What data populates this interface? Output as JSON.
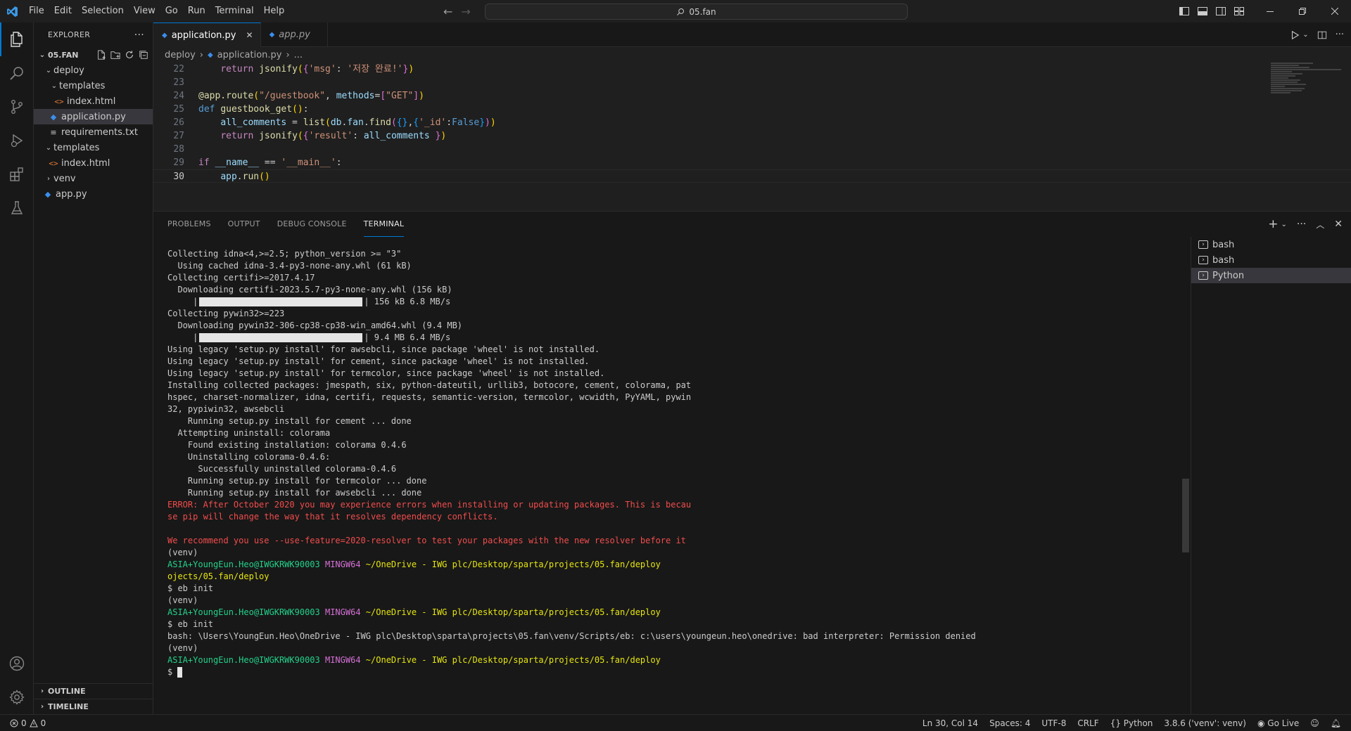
{
  "menu": [
    "File",
    "Edit",
    "Selection",
    "View",
    "Go",
    "Run",
    "Terminal",
    "Help"
  ],
  "command_center": {
    "text": "05.fan"
  },
  "sidebar": {
    "title": "EXPLORER",
    "root": "05.FAN",
    "tree": [
      {
        "label": "deploy",
        "type": "folder"
      },
      {
        "label": "templates",
        "type": "folder"
      },
      {
        "label": "index.html",
        "type": "html"
      },
      {
        "label": "application.py",
        "type": "py"
      },
      {
        "label": "requirements.txt",
        "type": "txt"
      },
      {
        "label": "templates",
        "type": "folder"
      },
      {
        "label": "index.html",
        "type": "html"
      },
      {
        "label": "venv",
        "type": "folder"
      },
      {
        "label": "app.py",
        "type": "py"
      }
    ],
    "outline": "OUTLINE",
    "timeline": "TIMELINE"
  },
  "editor": {
    "tabs": [
      {
        "label": "application.py"
      },
      {
        "label": "app.py"
      }
    ],
    "breadcrumb": {
      "folder": "deploy",
      "file": "application.py",
      "more": "..."
    },
    "lines": [
      {
        "num": "22",
        "text": "    return jsonify({'msg': '저장 완료!'})"
      },
      {
        "num": "23",
        "text": ""
      },
      {
        "num": "24",
        "text": "@app.route(\"/guestbook\", methods=[\"GET\"])"
      },
      {
        "num": "25",
        "text": "def guestbook_get():"
      },
      {
        "num": "26",
        "text": "    all_comments = list(db.fan.find({},{'_id':False}))"
      },
      {
        "num": "27",
        "text": "    return jsonify({'result': all_comments })"
      },
      {
        "num": "28",
        "text": ""
      },
      {
        "num": "29",
        "text": "if __name__ == '__main__':"
      },
      {
        "num": "30",
        "text": "    app.run()"
      }
    ]
  },
  "panel": {
    "tabs": [
      "PROBLEMS",
      "OUTPUT",
      "DEBUG CONSOLE",
      "TERMINAL"
    ],
    "terminals": [
      "bash",
      "bash",
      "Python"
    ],
    "lines": {
      "l1": "Collecting idna<4,>=2.5; python_version >= \"3\"",
      "l2": "  Using cached idna-3.4-py3-none-any.whl (61 kB)",
      "l3": "Collecting certifi>=2017.4.17",
      "l4": "  Downloading certifi-2023.5.7-py3-none-any.whl (156 kB)",
      "l5_prefix": "     |",
      "l5_suffix": "| 156 kB 6.8 MB/s",
      "l6": "Collecting pywin32>=223",
      "l7": "  Downloading pywin32-306-cp38-cp38-win_amd64.whl (9.4 MB)",
      "l8_prefix": "     |",
      "l8_suffix": "| 9.4 MB 6.4 MB/s",
      "l9": "Using legacy 'setup.py install' for awsebcli, since package 'wheel' is not installed.",
      "l10": "Using legacy 'setup.py install' for cement, since package 'wheel' is not installed.",
      "l11": "Using legacy 'setup.py install' for termcolor, since package 'wheel' is not installed.",
      "l12": "Installing collected packages: jmespath, six, python-dateutil, urllib3, botocore, cement, colorama, pat",
      "l13": "hspec, charset-normalizer, idna, certifi, requests, semantic-version, termcolor, wcwidth, PyYAML, pywin",
      "l14": "32, pypiwin32, awsebcli",
      "l15": "    Running setup.py install for cement ... done",
      "l16": "  Attempting uninstall: colorama",
      "l17": "    Found existing installation: colorama 0.4.6",
      "l18": "    Uninstalling colorama-0.4.6:",
      "l19": "      Successfully uninstalled colorama-0.4.6",
      "l20": "    Running setup.py install for termcolor ... done",
      "l21": "    Running setup.py install for awsebcli ... done",
      "l22": "ERROR: After October 2020 you may experience errors when installing or updating packages. This is becau",
      "l23": "se pip will change the way that it resolves dependency conflicts.",
      "l24": "",
      "l25": "We recommend you use --use-feature=2020-resolver to test your packages with the new resolver before it",
      "l26": "(venv)",
      "prompt_user": "ASIA+YoungEun.Heo@IWGKRWK90003",
      "prompt_host": "MINGW64",
      "prompt_path": "~/OneDrive - IWG plc/Desktop/sparta/projects/05.fan/deploy",
      "l28": "ojects/05.fan/deploy",
      "cmd": "$ eb init",
      "venv": "(venv)",
      "bash_err": "bash: \\Users\\YoungEun.Heo\\OneDrive - IWG plc\\Desktop\\sparta\\projects\\05.fan\\venv/Scripts/eb: c:\\users\\youngeun.heo\\onedrive: bad interpreter: Permission denied",
      "dollar": "$ "
    }
  },
  "status": {
    "errors": "0",
    "warnings": "0",
    "position": "Ln 30, Col 14",
    "spaces": "Spaces: 4",
    "encoding": "UTF-8",
    "eol": "CRLF",
    "language": "Python",
    "interpreter": "3.8.6 ('venv': venv)",
    "golive": "Go Live"
  }
}
